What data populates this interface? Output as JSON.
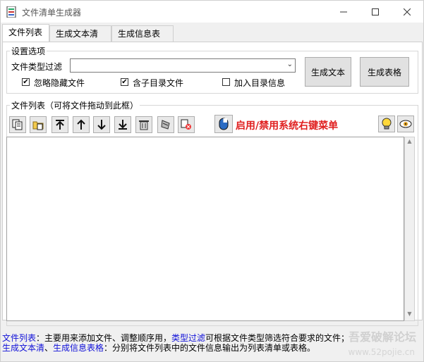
{
  "window": {
    "title": "文件清单生成器",
    "minimize_icon": "minimize-icon",
    "maximize_icon": "maximize-icon",
    "close_icon": "close-icon"
  },
  "tabs": [
    {
      "label": "文件列表",
      "active": true
    },
    {
      "label": "生成文本清单",
      "active": false
    },
    {
      "label": "生成信息表格",
      "active": false
    }
  ],
  "settings": {
    "legend": "设置选项",
    "filter_label": "文件类型过滤",
    "filter_value": "",
    "checks": [
      {
        "label": "忽略隐藏文件",
        "checked": true
      },
      {
        "label": "含子目录文件",
        "checked": true
      },
      {
        "label": "加入目录信息",
        "checked": false
      }
    ],
    "btn_text": "生成文本",
    "btn_table": "生成表格"
  },
  "filelist": {
    "legend": "文件列表（可将文件拖动到此框）",
    "tools": [
      "copy-icon",
      "paste-folder-icon",
      "move-top-icon",
      "move-up-icon",
      "move-down-icon",
      "move-bottom-icon",
      "delete-icon",
      "clear-icon",
      "remove-icon"
    ],
    "context_menu_icon": "mouse-icon",
    "context_menu_label": "启用/禁用系统右键菜单",
    "tip_icon": "lightbulb-icon",
    "about_icon": "eye-icon",
    "items": []
  },
  "help": {
    "line1_a": "文件列表",
    "line1_b": "：主要用来添加文件、调整顺序用，",
    "line1_c": "类型过滤",
    "line1_d": "可根据文件类型筛选符合要求的文件；",
    "line2_a": "生成文本清",
    "line2_b": "、",
    "line2_c": "生成信息表格",
    "line2_d": "：分别将文件列表中的文件信息输出为列表清单或表格。"
  },
  "watermark": {
    "main": "吾爱破解论坛",
    "sub": "www.52pojie.cn"
  }
}
